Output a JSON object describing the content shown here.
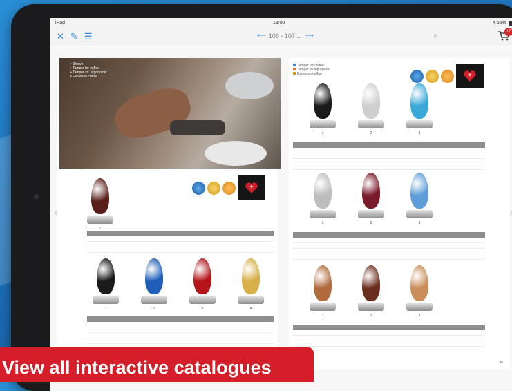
{
  "status_bar": {
    "device": "iPad",
    "time": "18:00",
    "battery": "4 55%"
  },
  "toolbar": {
    "close_icon": "close-icon",
    "tools_icon": "wrench-icon",
    "list_icon": "list-icon",
    "prev_arrow": "⟵",
    "page_range": "106 - 107 ...",
    "next_arrow": "⟶",
    "search_icon": "search-icon",
    "cart_icon": "cart-icon",
    "cart_count": "17"
  },
  "left_page": {
    "hero_list": [
      "Shown",
      "Tamper for coffee",
      "Tamper sd. ergonomic",
      "Espresso coffee"
    ],
    "featured_tamper": {
      "number": "1",
      "color": "#5a1f1a"
    },
    "tampers": [
      {
        "number": "1",
        "color": "#1b1b1b"
      },
      {
        "number": "2",
        "color": "#1f5fb8"
      },
      {
        "number": "3",
        "color": "#b4141a"
      },
      {
        "number": "4",
        "color": "#d8b04a"
      }
    ]
  },
  "right_page": {
    "legend": [
      "Tamper for coffee",
      "Tamper multipurpose",
      "Espresso coffee"
    ],
    "row1": [
      {
        "number": "1",
        "color": "#1a1a1a"
      },
      {
        "number": "2",
        "color": "#cfcfcf"
      },
      {
        "number": "3",
        "color": "#3aa8d8"
      }
    ],
    "row2": [
      {
        "number": "1",
        "color": "#bdbdbd"
      },
      {
        "number": "2",
        "color": "#7a1a2a"
      },
      {
        "number": "3",
        "color": "#5d9ed8"
      }
    ],
    "row3": [
      {
        "number": "1",
        "color": "#b06a3c"
      },
      {
        "number": "2",
        "color": "#6b2e1e"
      },
      {
        "number": "3",
        "color": "#c98d5a"
      }
    ],
    "page_number": "96"
  },
  "colors": {
    "accent": "#3a86d8",
    "banner": "#d51e29"
  },
  "banner_text": "View all interactive catalogues"
}
